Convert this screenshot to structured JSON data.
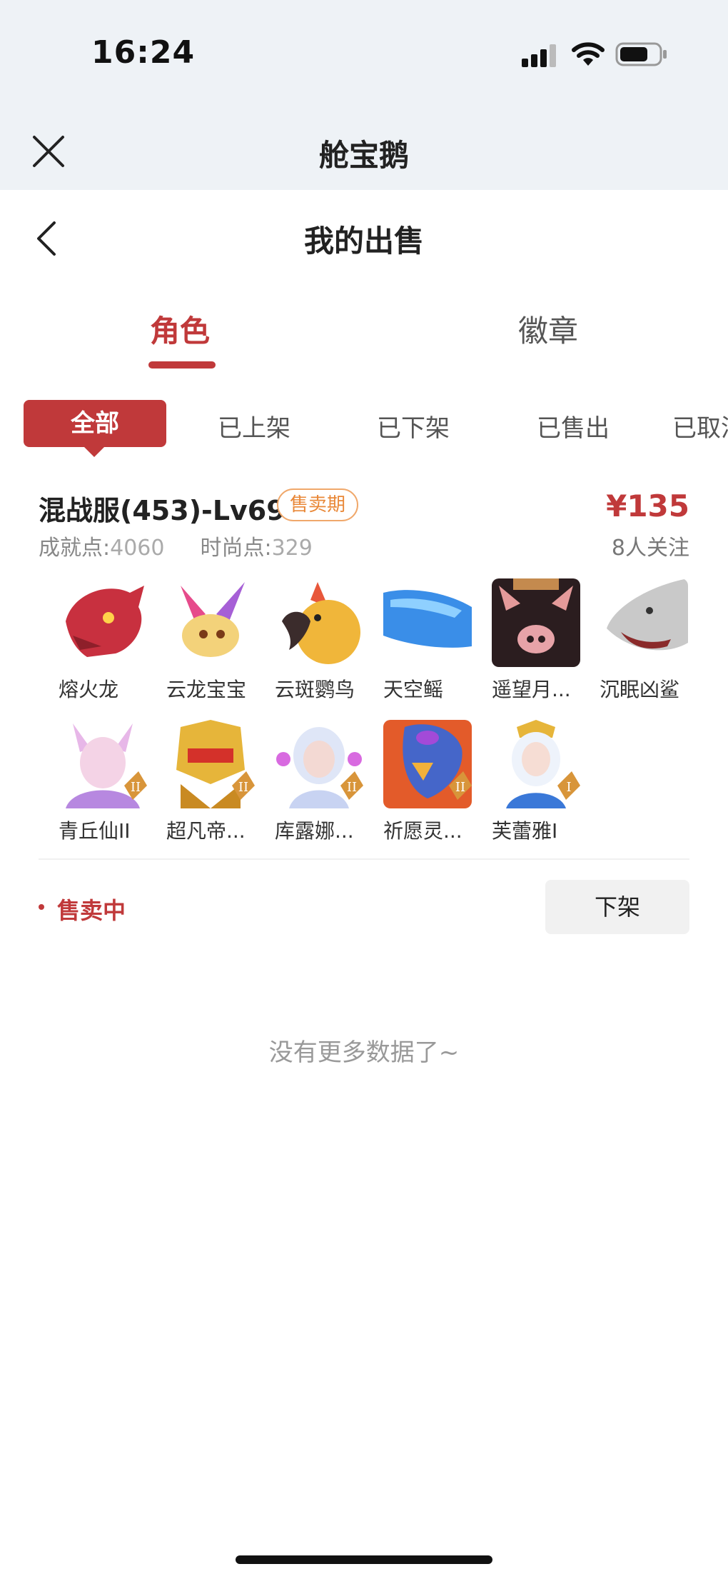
{
  "status_bar": {
    "time": "16:24"
  },
  "web_bar": {
    "title": "舱宝鹅"
  },
  "page": {
    "title": "我的出售"
  },
  "main_tabs": [
    {
      "label": "角色",
      "active": true
    },
    {
      "label": "徽章",
      "active": false
    }
  ],
  "filters": [
    {
      "label": "全部",
      "active": true
    },
    {
      "label": "已上架"
    },
    {
      "label": "已下架"
    },
    {
      "label": "已售出"
    },
    {
      "label": "已取消"
    }
  ],
  "listing": {
    "title": "混战服(453)-Lv69",
    "badge": "售卖期",
    "price": "¥135",
    "achievement_label": "成就点:",
    "achievement_value": "4060",
    "fashion_label": "时尚点:",
    "fashion_value": "329",
    "followers": "8人关注",
    "pets": [
      {
        "name": "熔火龙",
        "color": "#c8303f",
        "icon": "dragon-head-icon"
      },
      {
        "name": "云龙宝宝",
        "color": "#f3d27a",
        "icon": "baby-dragon-icon"
      },
      {
        "name": "云斑鹦鸟",
        "color": "#f0b63a",
        "icon": "parrot-icon"
      },
      {
        "name": "天空鳐",
        "color": "#3a8ee8",
        "icon": "sky-ray-icon"
      },
      {
        "name": "遥望月...",
        "color": "#2b1d1f",
        "icon": "pig-icon"
      },
      {
        "name": "沉眠凶鲨",
        "color": "#c9c9c9",
        "icon": "shark-icon"
      },
      {
        "name": "青丘仙II",
        "color": "#e7b7e8",
        "icon": "fox-fairy-icon",
        "tier": "II"
      },
      {
        "name": "超凡帝...",
        "color": "#e6b53a",
        "icon": "golden-armor-icon",
        "tier": "II"
      },
      {
        "name": "库露娜...",
        "color": "#c8d3f2",
        "icon": "moon-maiden-icon",
        "tier": "II"
      },
      {
        "name": "祈愿灵...",
        "color": "#e35b2a",
        "icon": "griffin-icon",
        "tier": "II"
      },
      {
        "name": "芙蕾雅I",
        "color": "#e0e8f5",
        "icon": "valkyrie-icon",
        "tier": "I"
      }
    ],
    "status": "售卖中",
    "action": "下架"
  },
  "footer": {
    "no_more": "没有更多数据了~"
  },
  "colors": {
    "accent": "#c0393a",
    "badge": "#e98838",
    "background_top": "#eef2f6"
  }
}
